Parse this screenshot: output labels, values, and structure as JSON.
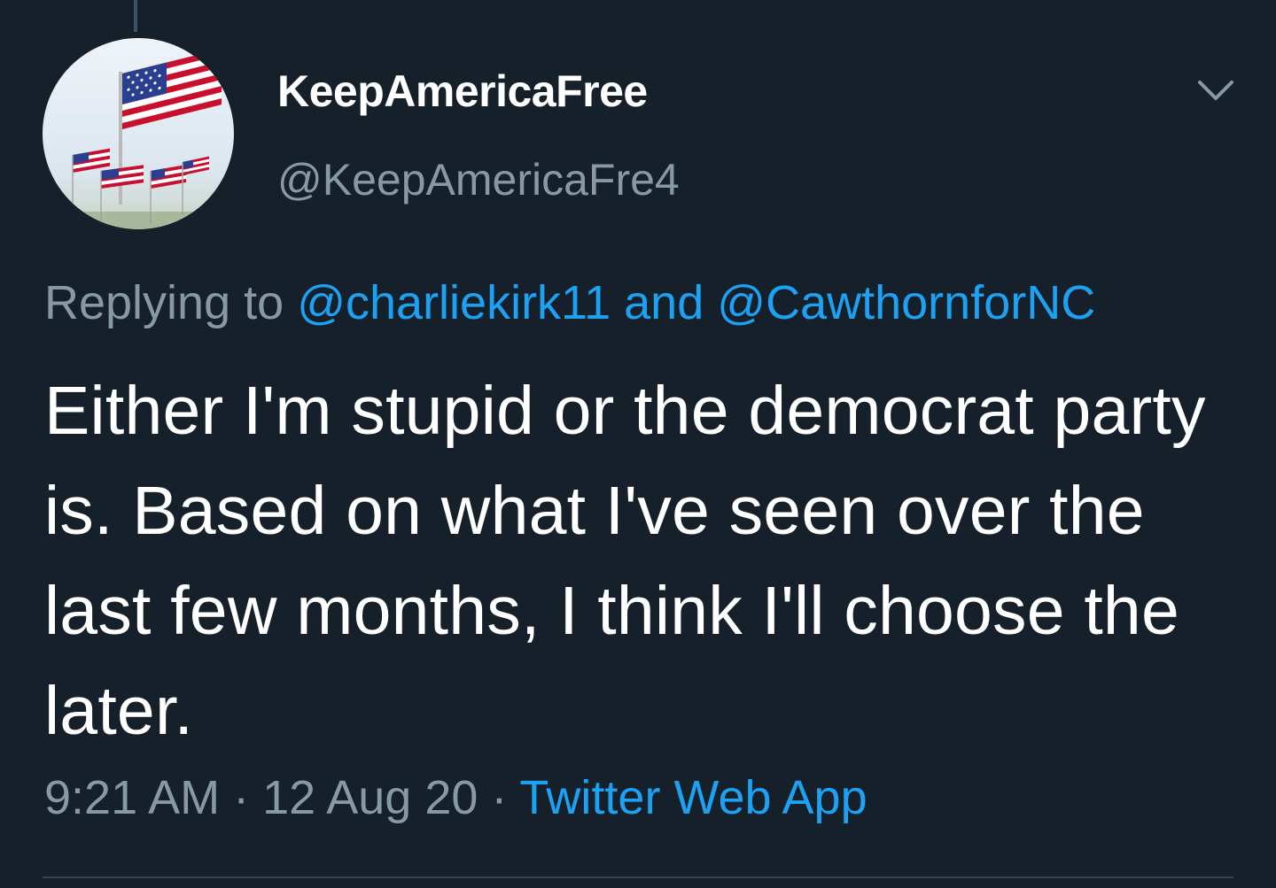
{
  "tweet": {
    "author": {
      "display_name": "KeepAmericaFree",
      "handle": "@KeepAmericaFre4",
      "avatar_icon": "american-flag-avatar"
    },
    "replying_to": {
      "prefix": "Replying to",
      "mentions": [
        "@charliekirk11",
        "@CawthornforNC"
      ],
      "conjunction": "and"
    },
    "text": "Either I'm stupid or the democrat party is. Based on what I've seen over the last few months, I think I'll choose the later.",
    "time": "9:21 AM",
    "date": "12 Aug 20",
    "separator": "·",
    "source": "Twitter Web App",
    "menu_icon": "chevron-down-icon"
  },
  "colors": {
    "background": "#15202b",
    "primary_text": "#ffffff",
    "secondary_text": "#8899a6",
    "accent": "#1da1f2",
    "divider": "#38444d"
  }
}
